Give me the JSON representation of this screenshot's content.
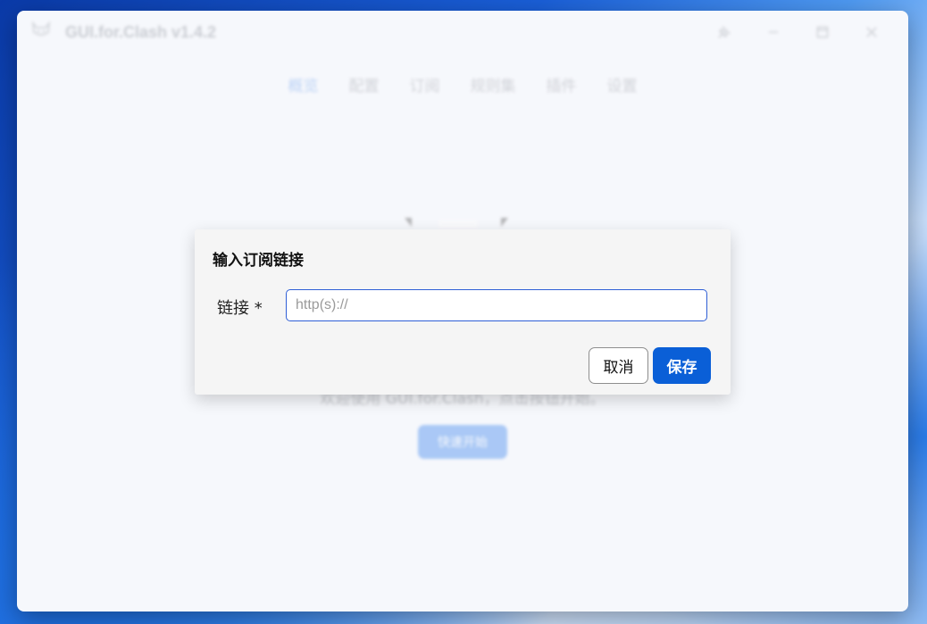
{
  "window": {
    "title": "GUI.for.Clash v1.4.2"
  },
  "nav": {
    "items": [
      "概览",
      "配置",
      "订阅",
      "规则集",
      "插件",
      "设置"
    ],
    "active_index": 0
  },
  "home": {
    "welcome_text": "欢迎使用 GUI.for.Clash，点击按钮开始。",
    "start_button": "快速开始"
  },
  "dialog": {
    "title": "输入订阅链接",
    "field_label": "链接 *",
    "field_placeholder": "http(s)://",
    "field_value": "",
    "cancel_label": "取消",
    "save_label": "保存"
  },
  "colors": {
    "accent": "#0a5fd7",
    "input_border": "#2f5fd6",
    "nav_active": "#6aa0ef"
  },
  "icons": {
    "pin": "pin-icon",
    "minimize": "minimize-icon",
    "maximize": "maximize-icon",
    "close": "close-icon",
    "logo": "cat-logo-icon"
  }
}
